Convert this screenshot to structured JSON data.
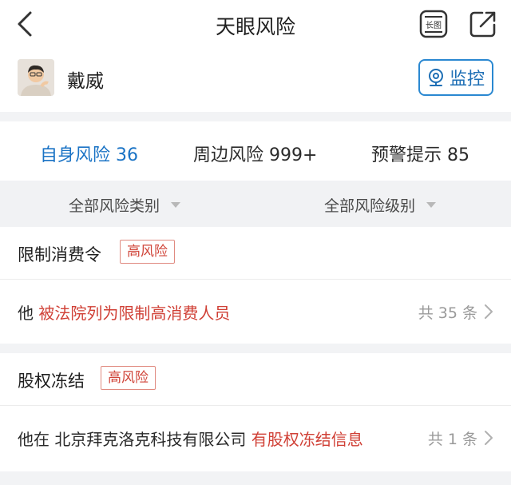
{
  "header": {
    "title": "天眼风险",
    "long_icon_text": "长图"
  },
  "profile": {
    "name": "戴威",
    "monitor_label": "监控"
  },
  "tabs": [
    {
      "label": "自身风险 36"
    },
    {
      "label": "周边风险 999+"
    },
    {
      "label": "预警提示 85"
    }
  ],
  "filters": {
    "category": "全部风险类别",
    "level": "全部风险级别"
  },
  "sections": [
    {
      "title": "限制消费令",
      "badge": "高风险",
      "subject": "他",
      "company": "",
      "highlight": "被法院列为限制高消费人员",
      "count": "共 35 条"
    },
    {
      "title": "股权冻结",
      "badge": "高风险",
      "subject": "他在",
      "company": "北京拜克洛克科技有限公司",
      "highlight": "有股权冻结信息",
      "count": "共 1 条"
    }
  ],
  "colors": {
    "accent": "#1a73c5",
    "risk_red": "#d04036"
  }
}
